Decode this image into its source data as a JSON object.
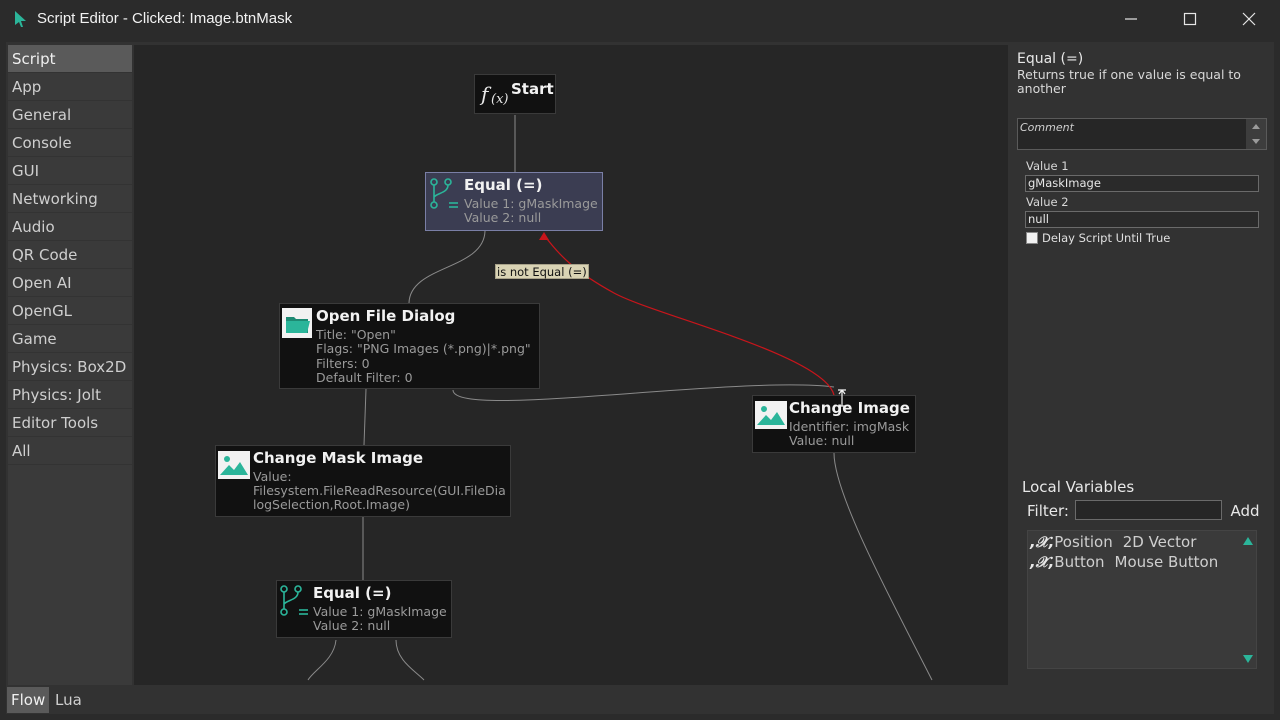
{
  "window": {
    "title": "Script Editor - Clicked: Image.btnMask"
  },
  "sidebar": {
    "items": [
      {
        "label": "Script",
        "active": true
      },
      {
        "label": "App"
      },
      {
        "label": "General"
      },
      {
        "label": "Console"
      },
      {
        "label": "GUI"
      },
      {
        "label": "Networking"
      },
      {
        "label": "Audio"
      },
      {
        "label": "QR Code"
      },
      {
        "label": "Open AI"
      },
      {
        "label": "OpenGL"
      },
      {
        "label": "Game"
      },
      {
        "label": "Physics: Box2D"
      },
      {
        "label": "Physics: Jolt"
      },
      {
        "label": "Editor Tools"
      },
      {
        "label": "All"
      }
    ]
  },
  "canvas": {
    "nodes": {
      "start": {
        "title": "Start",
        "icon": "function-icon"
      },
      "equal1": {
        "title": "Equal (=)",
        "lines": [
          "Value 1: gMaskImage",
          "Value 2: null"
        ],
        "icon": "branch-icon"
      },
      "open_file": {
        "title": "Open File Dialog",
        "lines": [
          "Title: \"Open\"",
          "Flags: \"PNG Images (*.png)|*.png\"",
          "Filters: 0",
          "Default Filter: 0"
        ],
        "icon": "folder-icon"
      },
      "change_image": {
        "title": "Change Image",
        "lines": [
          "Identifier: imgMask",
          "Value: null"
        ],
        "icon": "image-icon"
      },
      "change_mask": {
        "title": "Change Mask Image",
        "lines": [
          "Value:",
          "Filesystem.FileReadResource(GUI.FileDia",
          "logSelection,Root.Image)"
        ],
        "icon": "image-icon"
      },
      "equal2": {
        "title": "Equal (=)",
        "lines": [
          "Value 1: gMaskImage",
          "Value 2: null"
        ],
        "icon": "branch-icon"
      }
    },
    "edge_label": "is not Equal (=)",
    "accent_color": "#2bb59a",
    "wire_highlight_color": "#c8151b"
  },
  "panel": {
    "title": "Equal (=)",
    "description": "Returns true if one value is equal to another",
    "comment_placeholder": "Comment",
    "value1_label": "Value 1",
    "value1": "gMaskImage",
    "value2_label": "Value 2",
    "value2": "null",
    "delay_label": "Delay Script Until True",
    "local_vars_title": "Local Variables",
    "filter_label": "Filter:",
    "filter_value": "",
    "add_label": "Add",
    "variables": [
      {
        "name": "Position",
        "type": "2D Vector"
      },
      {
        "name": "Button",
        "type": "Mouse Button"
      }
    ]
  },
  "tabs": [
    {
      "label": "Flow",
      "active": true
    },
    {
      "label": "Lua"
    }
  ]
}
